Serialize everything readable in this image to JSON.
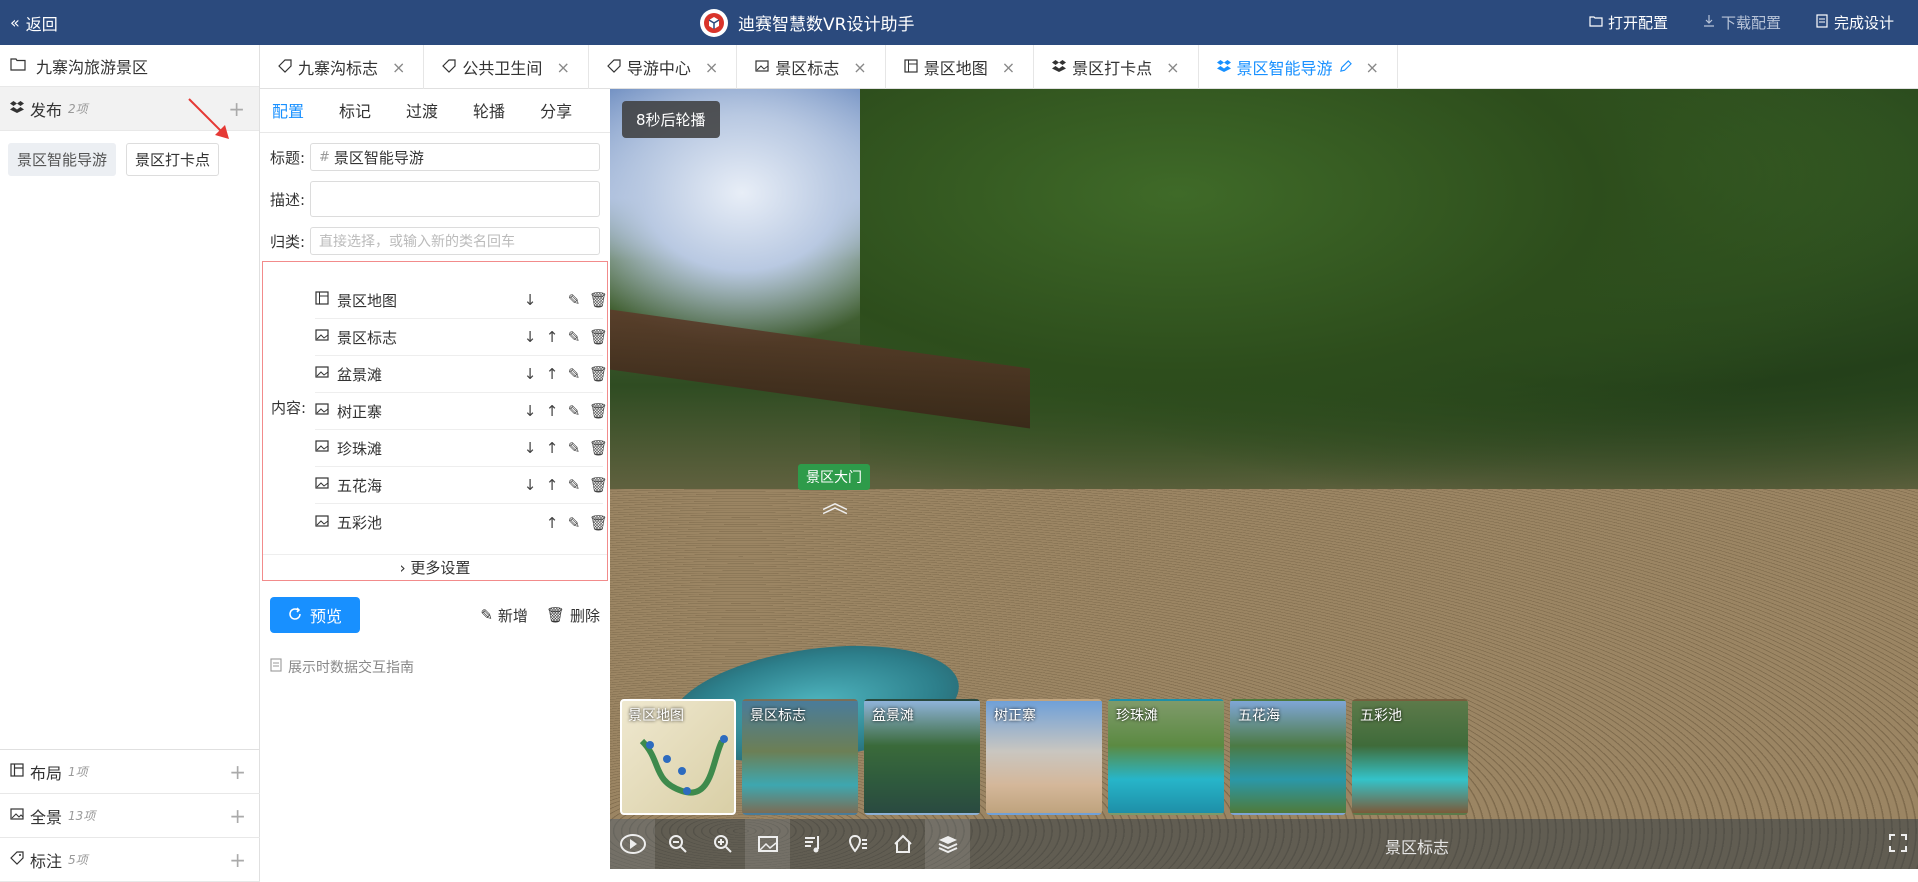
{
  "topbar": {
    "back_label": "返回",
    "title": "迪赛智慧数VR设计助手",
    "open_config": "打开配置",
    "download_config": "下载配置",
    "finish_design": "完成设计"
  },
  "sidebar": {
    "project_name": "九寨沟旅游景区",
    "sections": [
      {
        "title": "发布",
        "count": "2项"
      },
      {
        "title": "布局",
        "count": "1项"
      },
      {
        "title": "全景",
        "count": "13项"
      },
      {
        "title": "标注",
        "count": "5项"
      }
    ],
    "publish_items": [
      "景区智能导游",
      "景区打卡点"
    ]
  },
  "tabs": [
    {
      "label": "九寨沟标志",
      "icon": "tag-icon"
    },
    {
      "label": "公共卫生间",
      "icon": "tag-icon"
    },
    {
      "label": "导游中心",
      "icon": "tag-icon"
    },
    {
      "label": "景区标志",
      "icon": "image-icon"
    },
    {
      "label": "景区地图",
      "icon": "layout-icon"
    },
    {
      "label": "景区打卡点",
      "icon": "publish-icon"
    },
    {
      "label": "景区智能导游",
      "icon": "publish-icon",
      "active": true
    }
  ],
  "panel": {
    "subtabs": [
      "配置",
      "标记",
      "过渡",
      "轮播",
      "分享"
    ],
    "title_label": "标题:",
    "title_value": "景区智能导游",
    "desc_label": "描述:",
    "desc_value": "",
    "category_label": "归类:",
    "category_placeholder": "直接选择，或输入新的类名回车",
    "content_label": "内容:",
    "content_items": [
      {
        "name": "景区地图",
        "icon": "layout-icon"
      },
      {
        "name": "景区标志",
        "icon": "image-icon"
      },
      {
        "name": "盆景滩",
        "icon": "image-icon"
      },
      {
        "name": "树正寨",
        "icon": "image-icon"
      },
      {
        "name": "珍珠滩",
        "icon": "image-icon"
      },
      {
        "name": "五花海",
        "icon": "image-icon"
      },
      {
        "name": "五彩池",
        "icon": "image-icon"
      }
    ],
    "more_settings": "更多设置",
    "preview_label": "预览",
    "add_label": "新增",
    "delete_label": "删除",
    "guide_label": "展示时数据交互指南"
  },
  "viewer": {
    "timer_text": "8秒后轮播",
    "hotspot_label": "景区大门",
    "current_scene": "景区标志",
    "thumbnails": [
      "景区地图",
      "景区标志",
      "盆景滩",
      "树正寨",
      "珍珠滩",
      "五花海",
      "五彩池"
    ],
    "selected_thumbnail": "景区地图"
  },
  "colors": {
    "topbar": "#2b4a7d",
    "accent": "#1890ff",
    "annotation_arrow": "#e53935",
    "content_border": "#f28b8b"
  }
}
